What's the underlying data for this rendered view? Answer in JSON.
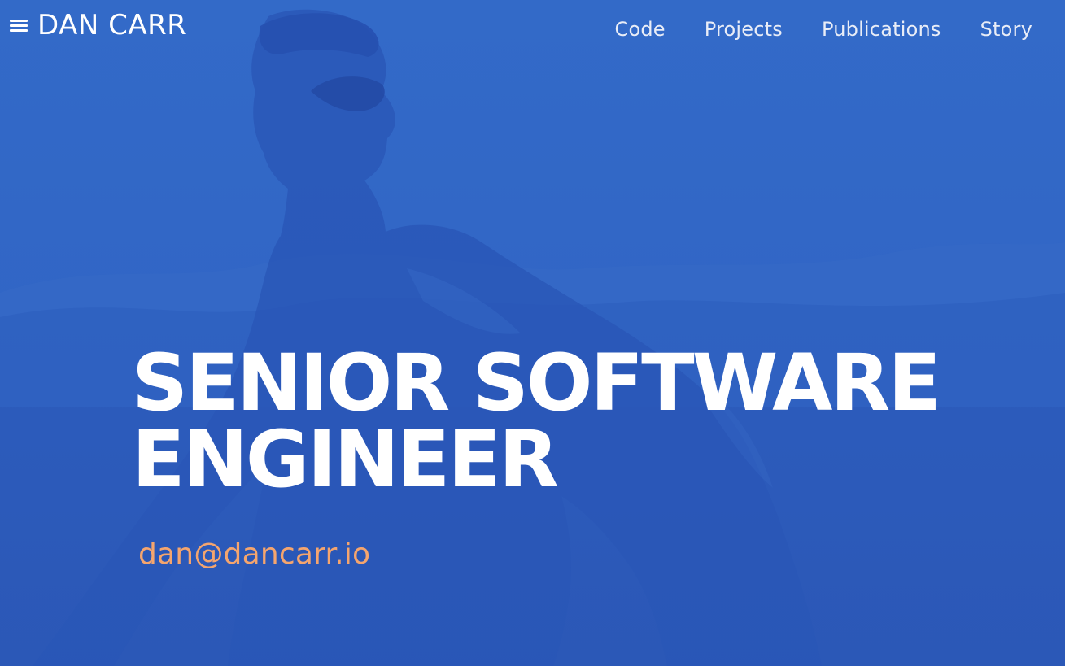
{
  "site": {
    "brand_name": "DAN CARR",
    "brand_menu_icon": "hamburger-menu-icon"
  },
  "nav": {
    "items": [
      {
        "label": "Code"
      },
      {
        "label": "Projects"
      },
      {
        "label": "Publications"
      },
      {
        "label": "Story"
      }
    ]
  },
  "hero": {
    "title_line_1": "SENIOR SOFTWARE",
    "title_line_2": "ENGINEER",
    "email": "dan@dancarr.io"
  },
  "colors": {
    "background_blue": "#2f63c4",
    "text_white": "#ffffff",
    "nav_text": "#e9edf7",
    "email_accent": "#f5a56e"
  }
}
